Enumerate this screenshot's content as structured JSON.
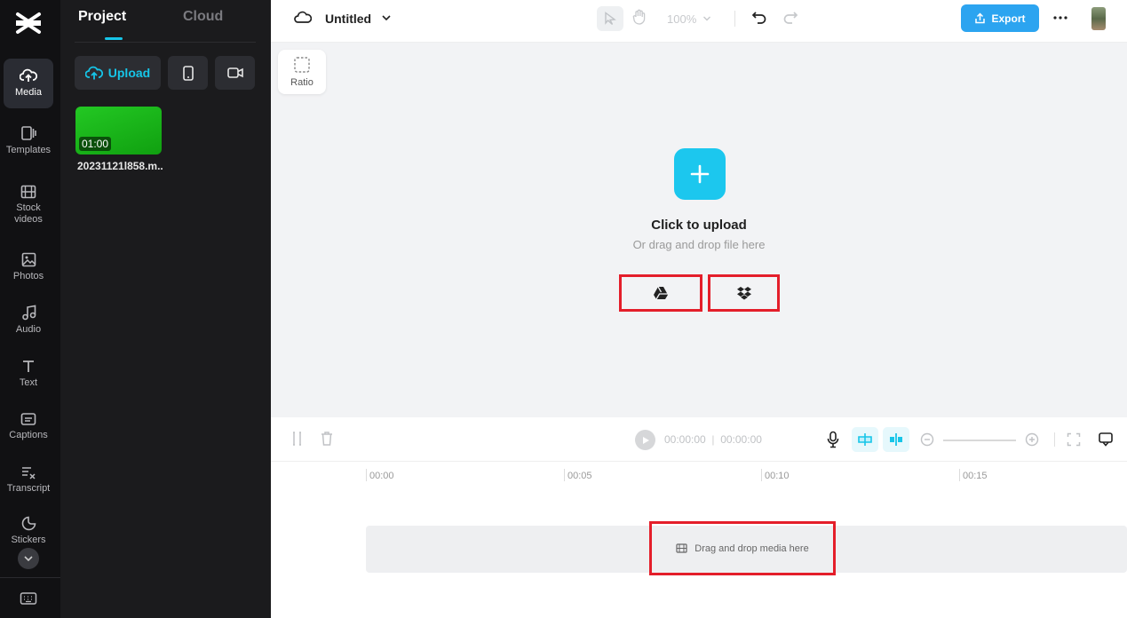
{
  "nav": {
    "items": [
      {
        "label": "Media",
        "icon": "cloud-upload-icon",
        "active": true
      },
      {
        "label": "Templates",
        "icon": "templates-icon"
      },
      {
        "label": "Stock videos",
        "icon": "film-icon"
      },
      {
        "label": "Photos",
        "icon": "image-icon"
      },
      {
        "label": "Audio",
        "icon": "music-note-icon"
      },
      {
        "label": "Text",
        "icon": "text-icon"
      },
      {
        "label": "Captions",
        "icon": "captions-icon"
      },
      {
        "label": "Transcript",
        "icon": "transcript-icon"
      },
      {
        "label": "Stickers",
        "icon": "sticker-icon"
      }
    ]
  },
  "panel": {
    "tabs": [
      "Project",
      "Cloud"
    ],
    "upload_label": "Upload",
    "media": [
      {
        "duration": "01:00",
        "name": "20231121l858.m..."
      }
    ]
  },
  "topbar": {
    "title": "Untitled",
    "zoom": "100%",
    "export_label": "Export"
  },
  "canvas": {
    "ratio_label": "Ratio",
    "upload_title": "Click to upload",
    "upload_sub": "Or drag and drop file here"
  },
  "timeline": {
    "current_time": "00:00:00",
    "total_time": "00:00:00",
    "ticks": [
      "00:00",
      "00:05",
      "00:10",
      "00:15"
    ],
    "drop_hint": "Drag and drop media here"
  },
  "colors": {
    "accent": "#16c5e8",
    "export": "#2ca4f0",
    "highlight_border": "#e41e2a"
  }
}
